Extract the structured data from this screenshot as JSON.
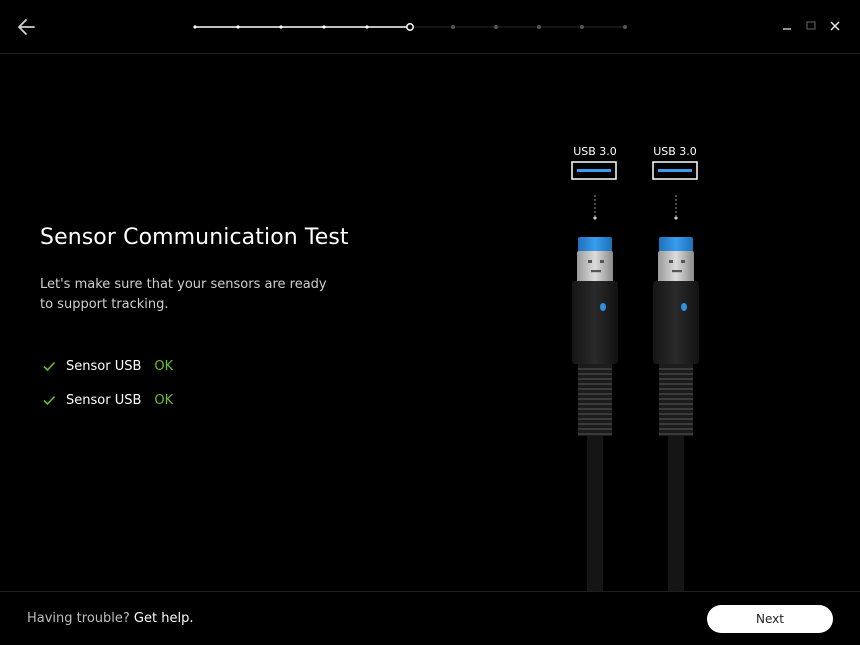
{
  "header": {
    "back_icon": "arrow-left-icon",
    "stepper": {
      "total_steps": 11,
      "completed_steps": 5,
      "current_step": 6
    },
    "window_controls": {
      "minimize_icon": "minimize-icon",
      "maximize_icon": "maximize-icon",
      "close_icon": "close-icon"
    }
  },
  "main": {
    "title": "Sensor Communication Test",
    "description": "Let's make sure that your sensors are ready to support tracking.",
    "checks": [
      {
        "label": "Sensor USB",
        "status": "OK",
        "icon": "checkmark-icon"
      },
      {
        "label": "Sensor USB",
        "status": "OK",
        "icon": "checkmark-icon"
      }
    ]
  },
  "illustration": {
    "ports": [
      {
        "label": "USB 3.0"
      },
      {
        "label": "USB 3.0"
      }
    ]
  },
  "footer": {
    "help_prefix": "Having trouble? ",
    "help_link": "Get help.",
    "next_label": "Next"
  },
  "colors": {
    "background": "#000000",
    "ok_green": "#6abf2a",
    "usb_blue": "#2f8fe0",
    "button_bg": "#ffffff"
  }
}
